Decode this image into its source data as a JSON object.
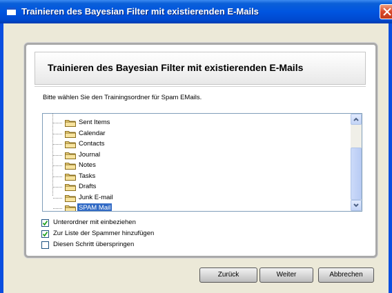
{
  "window": {
    "title": "Trainieren des Bayesian Filter mit existierenden E-Mails"
  },
  "panel": {
    "title": "Trainieren des Bayesian Filter mit existierenden E-Mails",
    "instruction": "Bitte wählen Sie den Trainingsordner für Spam EMails."
  },
  "tree": {
    "items": [
      {
        "label": "Sent Items",
        "selected": false
      },
      {
        "label": "Calendar",
        "selected": false
      },
      {
        "label": "Contacts",
        "selected": false
      },
      {
        "label": "Journal",
        "selected": false
      },
      {
        "label": "Notes",
        "selected": false
      },
      {
        "label": "Tasks",
        "selected": false
      },
      {
        "label": "Drafts",
        "selected": false
      },
      {
        "label": "Junk E-mail",
        "selected": false
      },
      {
        "label": "SPAM Mail",
        "selected": true
      }
    ]
  },
  "options": [
    {
      "label": "Unterordner mit einbeziehen",
      "checked": true
    },
    {
      "label": "Zur Liste der Spammer hinzufügen",
      "checked": true
    },
    {
      "label": "Diesen Schritt überspringen",
      "checked": false
    }
  ],
  "buttons": {
    "back": "Zurück",
    "next": "Weiter",
    "cancel": "Abbrechen"
  },
  "icons": {
    "folder": "folder-icon",
    "close": "close-icon",
    "scroll_up": "chevron-up-icon",
    "scroll_down": "chevron-down-icon",
    "check": "check-icon"
  },
  "colors": {
    "titlebar": "#0055e0",
    "selection": "#316ac5",
    "dialog_bg": "#ece9d8"
  }
}
